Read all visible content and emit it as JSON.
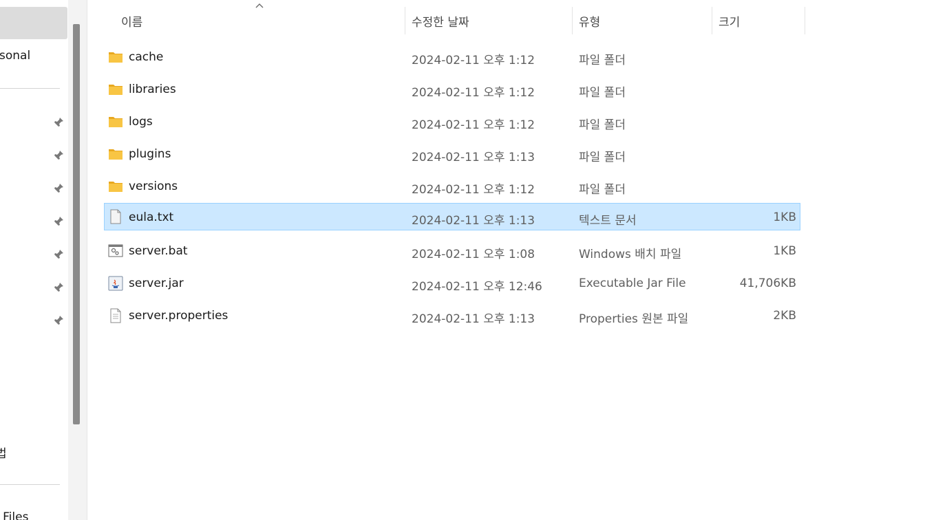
{
  "sidebar": {
    "personal_label": "rsonal",
    "law_label": "법",
    "files_label": "l Files",
    "pins": [
      "pin-icon",
      "pin-icon",
      "pin-icon",
      "pin-icon",
      "pin-icon",
      "pin-icon",
      "pin-icon"
    ]
  },
  "columns": {
    "name": "이름",
    "modified": "수정한 날짜",
    "type": "유형",
    "size": "크기"
  },
  "files": [
    {
      "name": "cache",
      "modified": "2024-02-11 오후 1:12",
      "type": "파일 폴더",
      "size": "",
      "icon": "folder-icon"
    },
    {
      "name": "libraries",
      "modified": "2024-02-11 오후 1:12",
      "type": "파일 폴더",
      "size": "",
      "icon": "folder-icon"
    },
    {
      "name": "logs",
      "modified": "2024-02-11 오후 1:12",
      "type": "파일 폴더",
      "size": "",
      "icon": "folder-icon"
    },
    {
      "name": "plugins",
      "modified": "2024-02-11 오후 1:13",
      "type": "파일 폴더",
      "size": "",
      "icon": "folder-icon"
    },
    {
      "name": "versions",
      "modified": "2024-02-11 오후 1:12",
      "type": "파일 폴더",
      "size": "",
      "icon": "folder-icon"
    },
    {
      "name": "eula.txt",
      "modified": "2024-02-11 오후 1:13",
      "type": "텍스트 문서",
      "size": "1KB",
      "icon": "text-file-icon",
      "selected": true
    },
    {
      "name": "server.bat",
      "modified": "2024-02-11 오후 1:08",
      "type": "Windows 배치 파일",
      "size": "1KB",
      "icon": "batch-file-icon"
    },
    {
      "name": "server.jar",
      "modified": "2024-02-11 오후 12:46",
      "type": "Executable Jar File",
      "size": "41,706KB",
      "icon": "jar-file-icon"
    },
    {
      "name": "server.properties",
      "modified": "2024-02-11 오후 1:13",
      "type": "Properties 원본 파일",
      "size": "2KB",
      "icon": "document-file-icon"
    }
  ],
  "colors": {
    "selection_bg": "#cce8ff",
    "selection_border": "#99d1ff",
    "folder": "#f8c544"
  }
}
